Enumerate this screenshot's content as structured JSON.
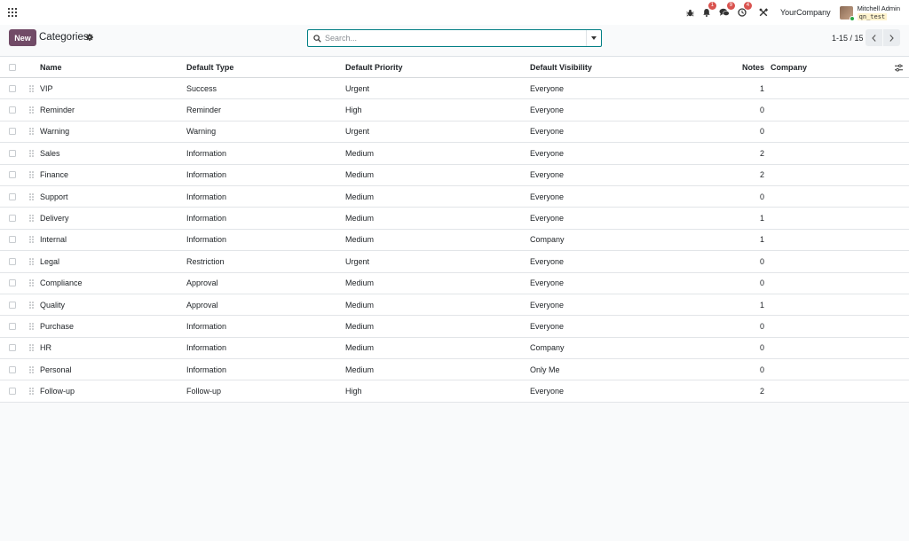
{
  "navbar": {
    "apps_icon": "grid-icon",
    "debug_icon": "bug-icon",
    "activity_badge": "1",
    "messages_badge": "9",
    "clock_badge": "4",
    "company_name": "YourCompany",
    "user_name": "Mitchell Admin",
    "database": "qn_test"
  },
  "control_panel": {
    "new_label": "New",
    "title": "Categories",
    "search_placeholder": "Search...",
    "pager_value": "1-15 / 15"
  },
  "colors": {
    "brand": "#714b67",
    "search_border": "#017e84",
    "badge": "#d9534f"
  },
  "table": {
    "columns": {
      "name": "Name",
      "type": "Default Type",
      "priority": "Default Priority",
      "visibility": "Default Visibility",
      "notes": "Notes",
      "company": "Company"
    },
    "rows": [
      {
        "name": "VIP",
        "type": "Success",
        "priority": "Urgent",
        "visibility": "Everyone",
        "notes": "1",
        "company": ""
      },
      {
        "name": "Reminder",
        "type": "Reminder",
        "priority": "High",
        "visibility": "Everyone",
        "notes": "0",
        "company": ""
      },
      {
        "name": "Warning",
        "type": "Warning",
        "priority": "Urgent",
        "visibility": "Everyone",
        "notes": "0",
        "company": ""
      },
      {
        "name": "Sales",
        "type": "Information",
        "priority": "Medium",
        "visibility": "Everyone",
        "notes": "2",
        "company": ""
      },
      {
        "name": "Finance",
        "type": "Information",
        "priority": "Medium",
        "visibility": "Everyone",
        "notes": "2",
        "company": ""
      },
      {
        "name": "Support",
        "type": "Information",
        "priority": "Medium",
        "visibility": "Everyone",
        "notes": "0",
        "company": ""
      },
      {
        "name": "Delivery",
        "type": "Information",
        "priority": "Medium",
        "visibility": "Everyone",
        "notes": "1",
        "company": ""
      },
      {
        "name": "Internal",
        "type": "Information",
        "priority": "Medium",
        "visibility": "Company",
        "notes": "1",
        "company": ""
      },
      {
        "name": "Legal",
        "type": "Restriction",
        "priority": "Urgent",
        "visibility": "Everyone",
        "notes": "0",
        "company": ""
      },
      {
        "name": "Compliance",
        "type": "Approval",
        "priority": "Medium",
        "visibility": "Everyone",
        "notes": "0",
        "company": ""
      },
      {
        "name": "Quality",
        "type": "Approval",
        "priority": "Medium",
        "visibility": "Everyone",
        "notes": "1",
        "company": ""
      },
      {
        "name": "Purchase",
        "type": "Information",
        "priority": "Medium",
        "visibility": "Everyone",
        "notes": "0",
        "company": ""
      },
      {
        "name": "HR",
        "type": "Information",
        "priority": "Medium",
        "visibility": "Company",
        "notes": "0",
        "company": ""
      },
      {
        "name": "Personal",
        "type": "Information",
        "priority": "Medium",
        "visibility": "Only Me",
        "notes": "0",
        "company": ""
      },
      {
        "name": "Follow-up",
        "type": "Follow-up",
        "priority": "High",
        "visibility": "Everyone",
        "notes": "2",
        "company": ""
      }
    ]
  }
}
